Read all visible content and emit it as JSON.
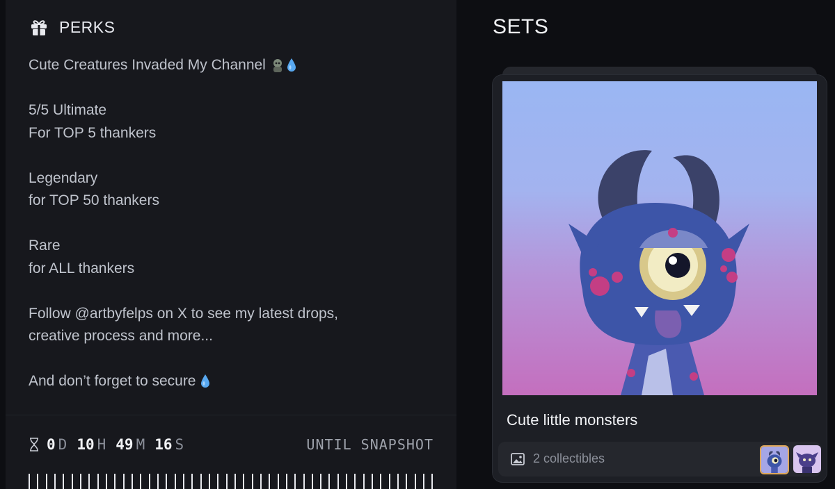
{
  "perks": {
    "title": "PERKS",
    "lines": [
      "Cute Creatures Invaded My Channel",
      "5/5 Ultimate",
      "For TOP 5 thankers",
      "Legendary",
      "for TOP 50 thankers",
      "Rare",
      "for ALL thankers",
      "Follow @artbyfelps on X to see my latest drops,",
      "creative process and more...",
      "And don’t forget to secure"
    ]
  },
  "timer": {
    "days": "0",
    "days_unit": "D",
    "hours": "10",
    "hours_unit": "H",
    "minutes": "49",
    "minutes_unit": "M",
    "seconds": "16",
    "seconds_unit": "S",
    "until_label": "UNTIL SNAPSHOT"
  },
  "sets": {
    "title": "SETS",
    "card": {
      "name": "Cute little monsters",
      "collectibles_label": "2 collectibles"
    }
  },
  "icons": {
    "gift": "gift-icon",
    "drop": "water-drop-icon",
    "hourglass": "hourglass-icon",
    "image": "image-icon"
  },
  "colors": {
    "accent_border": "#e0a85a",
    "drop": "#58a8f0"
  }
}
